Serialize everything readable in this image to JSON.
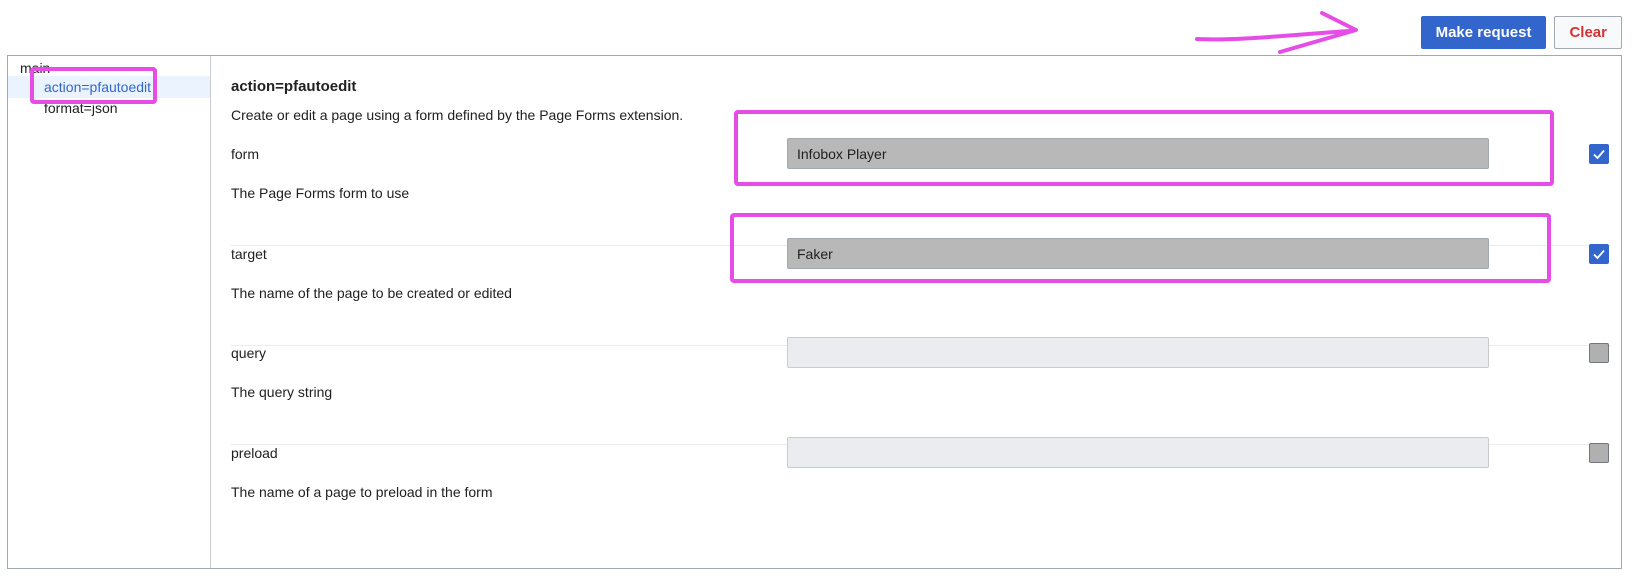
{
  "toolbar": {
    "make_request_label": "Make request",
    "clear_label": "Clear"
  },
  "sidebar": {
    "root_label": "main",
    "items": [
      {
        "label": "action=pfautoedit",
        "selected": true
      },
      {
        "label": "format=json",
        "selected": false
      }
    ]
  },
  "module": {
    "title": "action=pfautoedit",
    "description": "Create or edit a page using a form defined by the Page Forms extension."
  },
  "params": [
    {
      "name": "form",
      "value": "Infobox Player",
      "placeholder": "",
      "description": "The Page Forms form to use",
      "checked": true
    },
    {
      "name": "target",
      "value": "Faker",
      "placeholder": "",
      "description": "The name of the page to be created or edited",
      "checked": true
    },
    {
      "name": "query",
      "value": "",
      "placeholder": "",
      "description": "The query string",
      "checked": false
    },
    {
      "name": "preload",
      "value": "",
      "placeholder": "",
      "description": "The name of a page to preload in the form",
      "checked": false
    }
  ],
  "colors": {
    "accent": "#3366cc",
    "annotation": "#e64ce6",
    "clear_text": "#d73333"
  }
}
